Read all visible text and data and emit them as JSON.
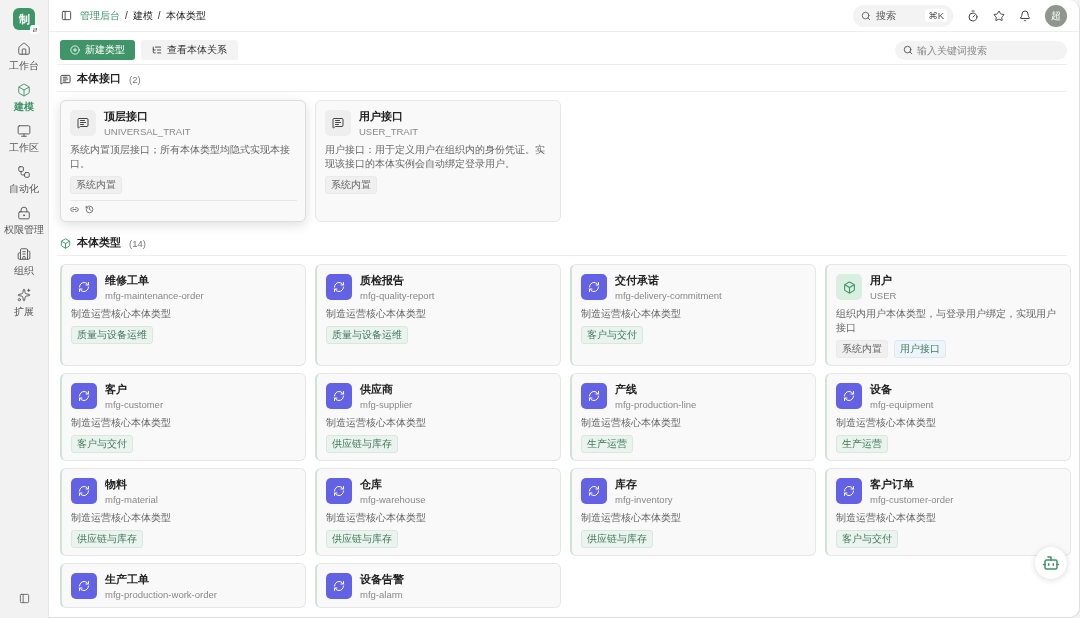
{
  "app_logo": {
    "text": "制"
  },
  "sidebar": {
    "items": [
      {
        "label": "工作台",
        "selected": false
      },
      {
        "label": "建模",
        "selected": true
      },
      {
        "label": "工作区",
        "selected": false
      },
      {
        "label": "自动化",
        "selected": false
      },
      {
        "label": "权限管理",
        "selected": false
      },
      {
        "label": "组织",
        "selected": false
      },
      {
        "label": "扩展",
        "selected": false
      }
    ]
  },
  "breadcrumb": [
    {
      "label": "管理后台",
      "link": true
    },
    {
      "label": "建模",
      "link": false
    },
    {
      "label": "本体类型",
      "link": false
    }
  ],
  "breadcrumb_separator": "/",
  "topbar": {
    "search_label": "搜索",
    "shortcut": "⌘K",
    "avatar": "超"
  },
  "toolbar": {
    "primary_button": "新建类型",
    "secondary_button": "查看本体关系",
    "search": {
      "placeholder": "输入关键词搜索"
    }
  },
  "interfaces": {
    "title": "本体接口",
    "count": "(2)",
    "cards": [
      {
        "title": "顶层接口",
        "code": "UNIVERSAL_TRAIT",
        "description": "系统内置顶层接口；所有本体类型均隐式实现本接口。",
        "tags": [
          {
            "label": "系统内置",
            "kind": "system"
          }
        ],
        "hovered": true
      },
      {
        "title": "用户接口",
        "code": "USER_TRAIT",
        "description": "用户接口：用于定义用户在组织内的身份凭证。实现该接口的本体实例会自动绑定登录用户。",
        "tags": [
          {
            "label": "系统内置",
            "kind": "system"
          }
        ],
        "hovered": false
      }
    ]
  },
  "types": {
    "title": "本体类型",
    "count": "(14)",
    "cards": [
      {
        "title": "维修工单",
        "code": "mfg-maintenance-order",
        "kind": "custom",
        "description": "制造运营核心本体类型",
        "tags": [
          {
            "label": "质量与设备运维",
            "kind": "category"
          }
        ]
      },
      {
        "title": "质检报告",
        "code": "mfg-quality-report",
        "kind": "custom",
        "description": "制造运营核心本体类型",
        "tags": [
          {
            "label": "质量与设备运维",
            "kind": "category"
          }
        ]
      },
      {
        "title": "交付承诺",
        "code": "mfg-delivery-commitment",
        "kind": "custom",
        "description": "制造运营核心本体类型",
        "tags": [
          {
            "label": "客户与交付",
            "kind": "category"
          }
        ]
      },
      {
        "title": "用户",
        "code": "USER",
        "kind": "builtin",
        "description": "组织内用户本体类型，与登录用户绑定，实现用户接口",
        "tags": [
          {
            "label": "系统内置",
            "kind": "system"
          },
          {
            "label": "用户接口",
            "kind": "interface"
          }
        ]
      },
      {
        "title": "客户",
        "code": "mfg-customer",
        "kind": "custom",
        "description": "制造运营核心本体类型",
        "tags": [
          {
            "label": "客户与交付",
            "kind": "category"
          }
        ]
      },
      {
        "title": "供应商",
        "code": "mfg-supplier",
        "kind": "custom",
        "description": "制造运营核心本体类型",
        "tags": [
          {
            "label": "供应链与库存",
            "kind": "category"
          }
        ]
      },
      {
        "title": "产线",
        "code": "mfg-production-line",
        "kind": "custom",
        "description": "制造运营核心本体类型",
        "tags": [
          {
            "label": "生产运营",
            "kind": "category"
          }
        ]
      },
      {
        "title": "设备",
        "code": "mfg-equipment",
        "kind": "custom",
        "description": "制造运营核心本体类型",
        "tags": [
          {
            "label": "生产运营",
            "kind": "category"
          }
        ]
      },
      {
        "title": "物料",
        "code": "mfg-material",
        "kind": "custom",
        "description": "制造运营核心本体类型",
        "tags": [
          {
            "label": "供应链与库存",
            "kind": "category"
          }
        ]
      },
      {
        "title": "仓库",
        "code": "mfg-warehouse",
        "kind": "custom",
        "description": "制造运营核心本体类型",
        "tags": [
          {
            "label": "供应链与库存",
            "kind": "category"
          }
        ]
      },
      {
        "title": "库存",
        "code": "mfg-inventory",
        "kind": "custom",
        "description": "制造运营核心本体类型",
        "tags": [
          {
            "label": "供应链与库存",
            "kind": "category"
          }
        ]
      },
      {
        "title": "客户订单",
        "code": "mfg-customer-order",
        "kind": "custom",
        "description": "制造运营核心本体类型",
        "tags": [
          {
            "label": "客户与交付",
            "kind": "category"
          }
        ]
      },
      {
        "title": "生产工单",
        "code": "mfg-production-work-order",
        "kind": "custom"
      },
      {
        "title": "设备告警",
        "code": "mfg-alarm",
        "kind": "custom"
      }
    ]
  }
}
